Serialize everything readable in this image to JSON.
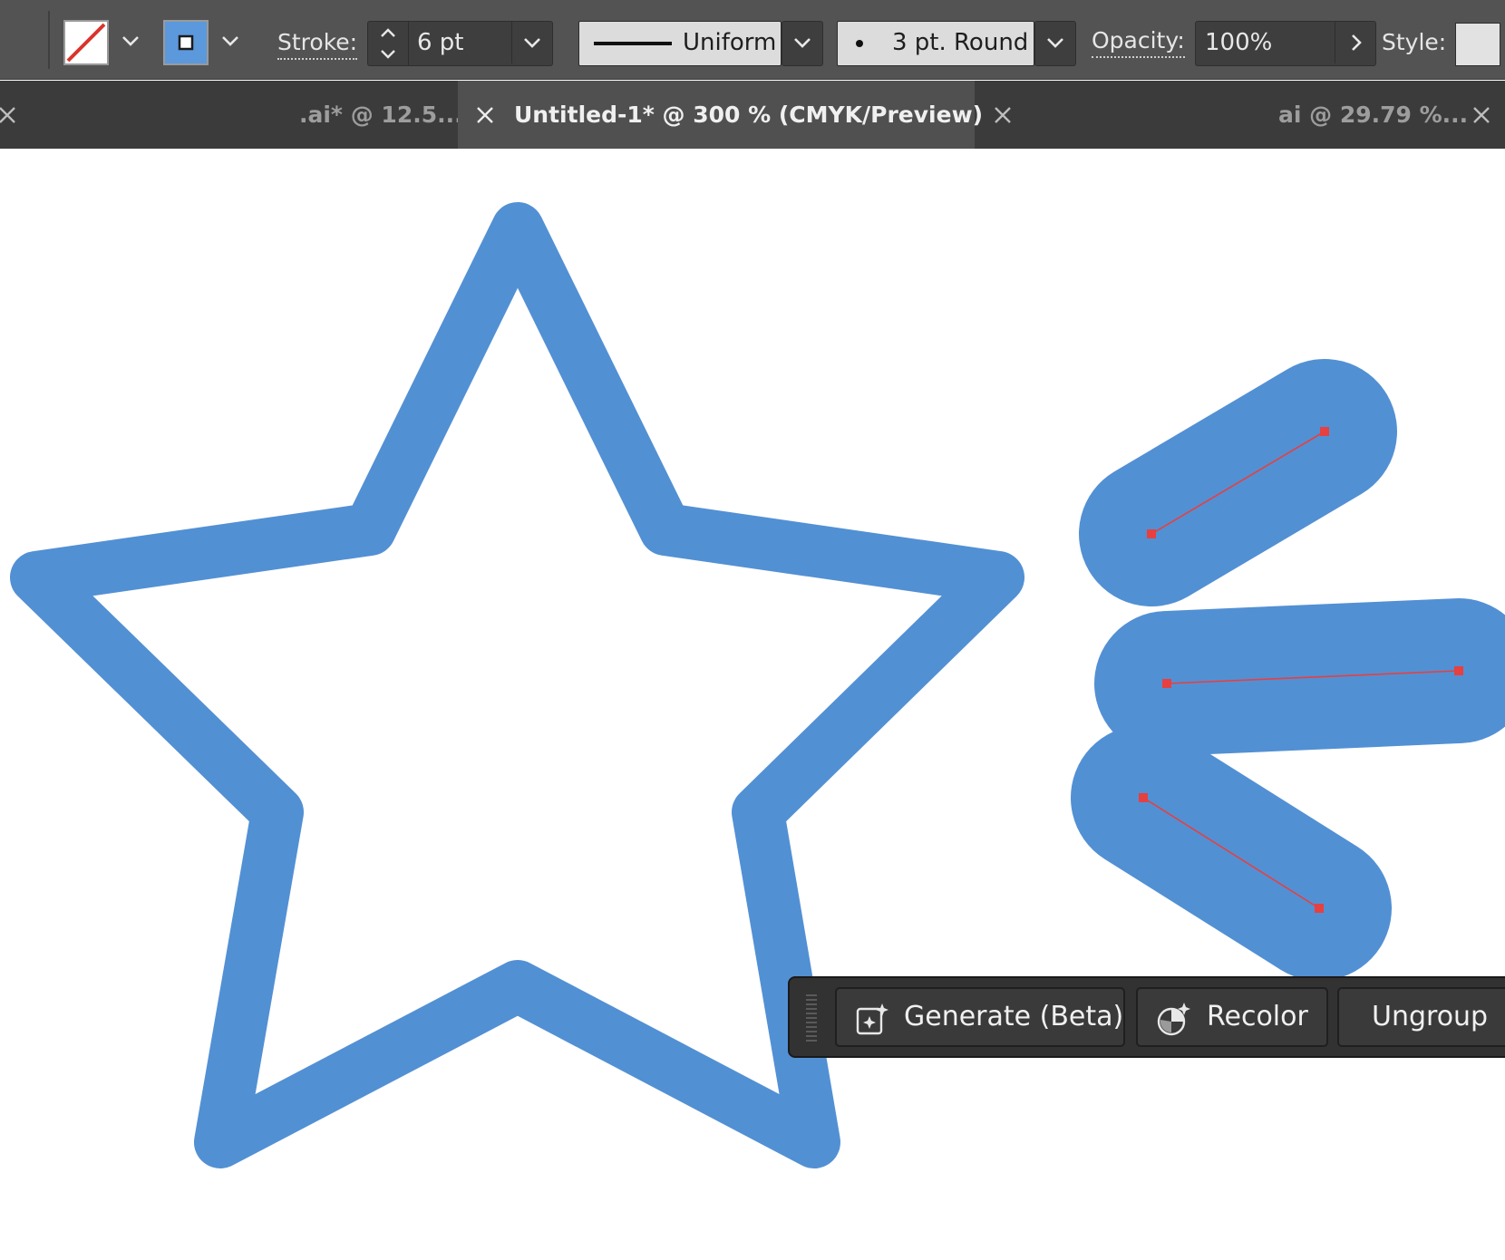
{
  "control_bar": {
    "fill_swatch_icon": "no-fill-swatch-icon",
    "stroke_swatch_icon": "stroke-swatch-icon",
    "stroke_label": "Stroke:",
    "stroke_weight_value": "6 pt",
    "profile_value": "Uniform",
    "brush_value": "3 pt. Round",
    "opacity_label": "Opacity:",
    "opacity_value": "100%",
    "style_label": "Style:"
  },
  "tabs": [
    {
      "label": ".ai* @ 12.5...",
      "active": false
    },
    {
      "label": "Untitled-1* @ 300 % (CMYK/Preview)",
      "active": true
    },
    {
      "label": "ai @ 29.79 %...",
      "active": false
    }
  ],
  "canvas": {
    "artwork": [
      "star-outline",
      "sparkle-stroke-top",
      "sparkle-stroke-middle",
      "sparkle-stroke-bottom"
    ],
    "stroke_color": "#5290d4",
    "path_highlight_color": "#e64040"
  },
  "contextual_taskbar": {
    "generate_label": "Generate (Beta)",
    "recolor_label": "Recolor",
    "ungroup_label": "Ungroup"
  },
  "colors": {
    "panel_bg": "#535353",
    "tab_bar_bg": "#3b3b3b",
    "active_tab_bg": "#505050",
    "accent_blue": "#5290d4"
  }
}
